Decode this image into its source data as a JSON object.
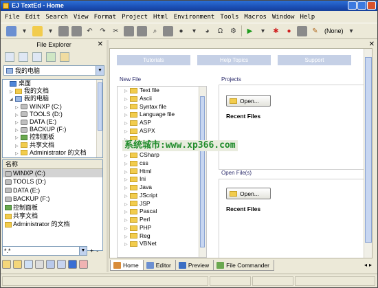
{
  "window": {
    "title": "EJ TextEd - Home"
  },
  "menu": [
    "File",
    "Edit",
    "Search",
    "View",
    "Format",
    "Project",
    "Html",
    "Environment",
    "Tools",
    "Macros",
    "Window",
    "Help"
  ],
  "toolbar": {
    "highlighter_value": "(None)"
  },
  "explorer": {
    "title": "File Explorer",
    "drive_selected": "我的电脑",
    "tree": [
      {
        "label": "桌面",
        "icon": "desktop-icon",
        "indent": 0,
        "expander": ""
      },
      {
        "label": "我的文档",
        "icon": "folder-icon",
        "indent": 1,
        "expander": "▷"
      },
      {
        "label": "我的电脑",
        "icon": "computer-icon",
        "indent": 1,
        "expander": "◢"
      },
      {
        "label": "WINXP (C:)",
        "icon": "drive-icon",
        "indent": 2,
        "expander": "▷"
      },
      {
        "label": "TOOLS (D:)",
        "icon": "drive-icon",
        "indent": 2,
        "expander": "▷"
      },
      {
        "label": "DATA (E:)",
        "icon": "drive-icon",
        "indent": 2,
        "expander": "▷"
      },
      {
        "label": "BACKUP (F:)",
        "icon": "drive-icon",
        "indent": 2,
        "expander": "▷"
      },
      {
        "label": "控制面板",
        "icon": "control-panel-icon",
        "indent": 2,
        "expander": "▷"
      },
      {
        "label": "共享文档",
        "icon": "folder-icon",
        "indent": 2,
        "expander": "▷"
      },
      {
        "label": "Administrator 的文档",
        "icon": "folder-icon",
        "indent": 2,
        "expander": "▷"
      }
    ],
    "list_header": "名称",
    "list": [
      {
        "label": "WINXP (C:)",
        "icon": "drive-icon",
        "selected": true
      },
      {
        "label": "TOOLS (D:)",
        "icon": "drive-icon",
        "selected": false
      },
      {
        "label": "DATA (E:)",
        "icon": "drive-icon",
        "selected": false
      },
      {
        "label": "BACKUP (F:)",
        "icon": "drive-icon",
        "selected": false
      },
      {
        "label": "控制面板",
        "icon": "control-panel-icon",
        "selected": false
      },
      {
        "label": "共享文档",
        "icon": "folder-icon",
        "selected": false
      },
      {
        "label": "Administrator 的文档",
        "icon": "folder-icon",
        "selected": false
      }
    ],
    "filter_value": "*.*"
  },
  "home": {
    "tabs": [
      "Tutorials",
      "Help Topics",
      "Support"
    ],
    "new_file_label": "New File",
    "new_file_items": [
      "Text file",
      "Ascii",
      "Syntax file",
      "Language file",
      "ASP",
      "ASPX",
      "",
      "",
      "CSharp",
      "css",
      "Html",
      "Ini",
      "Java",
      "JScript",
      "JSP",
      "Pascal",
      "Perl",
      "PHP",
      "Reg",
      "VBNet"
    ],
    "projects_label": "Projects",
    "projects_open": "Open...",
    "projects_recent": "Recent Files",
    "openfiles_label": "Open File(s)",
    "openfiles_open": "Open...",
    "openfiles_recent": "Recent Files"
  },
  "watermark": "系统城市:www.xp366.com",
  "doc_tabs": [
    {
      "label": "Home",
      "icon": "home-icon",
      "active": true
    },
    {
      "label": "Editor",
      "icon": "editor-icon",
      "active": false
    },
    {
      "label": "Preview",
      "icon": "preview-icon",
      "active": false
    },
    {
      "label": "File Commander",
      "icon": "file-commander-icon",
      "active": false
    }
  ]
}
